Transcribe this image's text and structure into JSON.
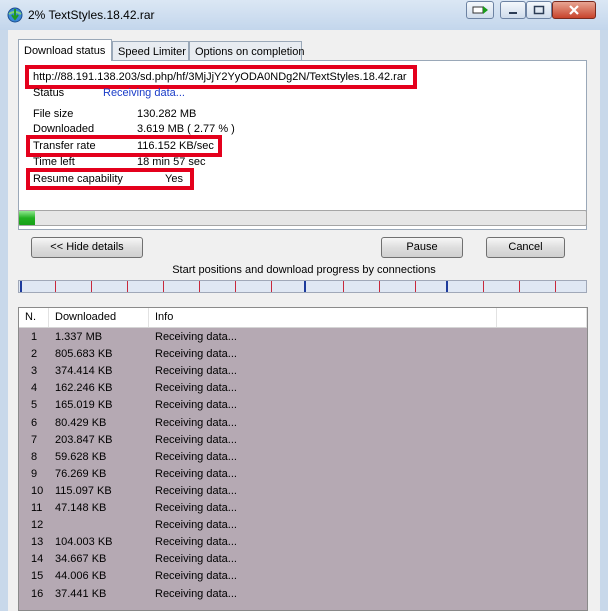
{
  "window": {
    "title": "2% TextStyles.18.42.rar"
  },
  "tabs": [
    {
      "label": "Download status"
    },
    {
      "label": "Speed Limiter"
    },
    {
      "label": "Options on completion"
    }
  ],
  "status_panel": {
    "url": "http://88.191.138.203/sd.php/hf/3MjJjY2YyODA0NDg2N/TextStyles.18.42.rar",
    "status_label": "Status",
    "status_value": "Receiving data...",
    "file_size_label": "File size",
    "file_size_value": "130.282  MB",
    "downloaded_label": "Downloaded",
    "downloaded_value": "3.619  MB  ( 2.77 % )",
    "transfer_rate_label": "Transfer rate",
    "transfer_rate_value": "116.152  KB/sec",
    "time_left_label": "Time left",
    "time_left_value": "18 min 57 sec",
    "resume_label": "Resume capability",
    "resume_value": "Yes"
  },
  "progress": {
    "percent": 2.77
  },
  "buttons": {
    "hide_details": "<< Hide details",
    "pause": "Pause",
    "cancel": "Cancel"
  },
  "connections_caption": "Start positions and download progress by connections",
  "table": {
    "headers": [
      "N.",
      "Downloaded",
      "Info"
    ],
    "rows": [
      {
        "n": "1",
        "downloaded": "1.337  MB",
        "info": "Receiving data..."
      },
      {
        "n": "2",
        "downloaded": "805.683  KB",
        "info": "Receiving data..."
      },
      {
        "n": "3",
        "downloaded": "374.414  KB",
        "info": "Receiving data..."
      },
      {
        "n": "4",
        "downloaded": "162.246  KB",
        "info": "Receiving data..."
      },
      {
        "n": "5",
        "downloaded": "165.019  KB",
        "info": "Receiving data..."
      },
      {
        "n": "6",
        "downloaded": "80.429  KB",
        "info": "Receiving data..."
      },
      {
        "n": "7",
        "downloaded": "203.847  KB",
        "info": "Receiving data..."
      },
      {
        "n": "8",
        "downloaded": "59.628  KB",
        "info": "Receiving data..."
      },
      {
        "n": "9",
        "downloaded": "76.269  KB",
        "info": "Receiving data..."
      },
      {
        "n": "10",
        "downloaded": "115.097  KB",
        "info": "Receiving data..."
      },
      {
        "n": "11",
        "downloaded": "47.148  KB",
        "info": "Receiving data..."
      },
      {
        "n": "12",
        "downloaded": "",
        "info": "Receiving data..."
      },
      {
        "n": "13",
        "downloaded": "104.003  KB",
        "info": "Receiving data..."
      },
      {
        "n": "14",
        "downloaded": "34.667  KB",
        "info": "Receiving data..."
      },
      {
        "n": "15",
        "downloaded": "44.006  KB",
        "info": "Receiving data..."
      },
      {
        "n": "16",
        "downloaded": "37.441  KB",
        "info": "Receiving data..."
      }
    ]
  },
  "icons": {
    "app": "download-manager-globe-icon",
    "extra": "arrow-right-icon",
    "minimize": "minimize-icon",
    "maximize": "maximize-icon",
    "close": "close-icon"
  },
  "colors": {
    "status_value": "#1a3cc8",
    "highlight_box": "#e4001c",
    "progress": "#22b022",
    "table_background": "#b5a9b3"
  }
}
